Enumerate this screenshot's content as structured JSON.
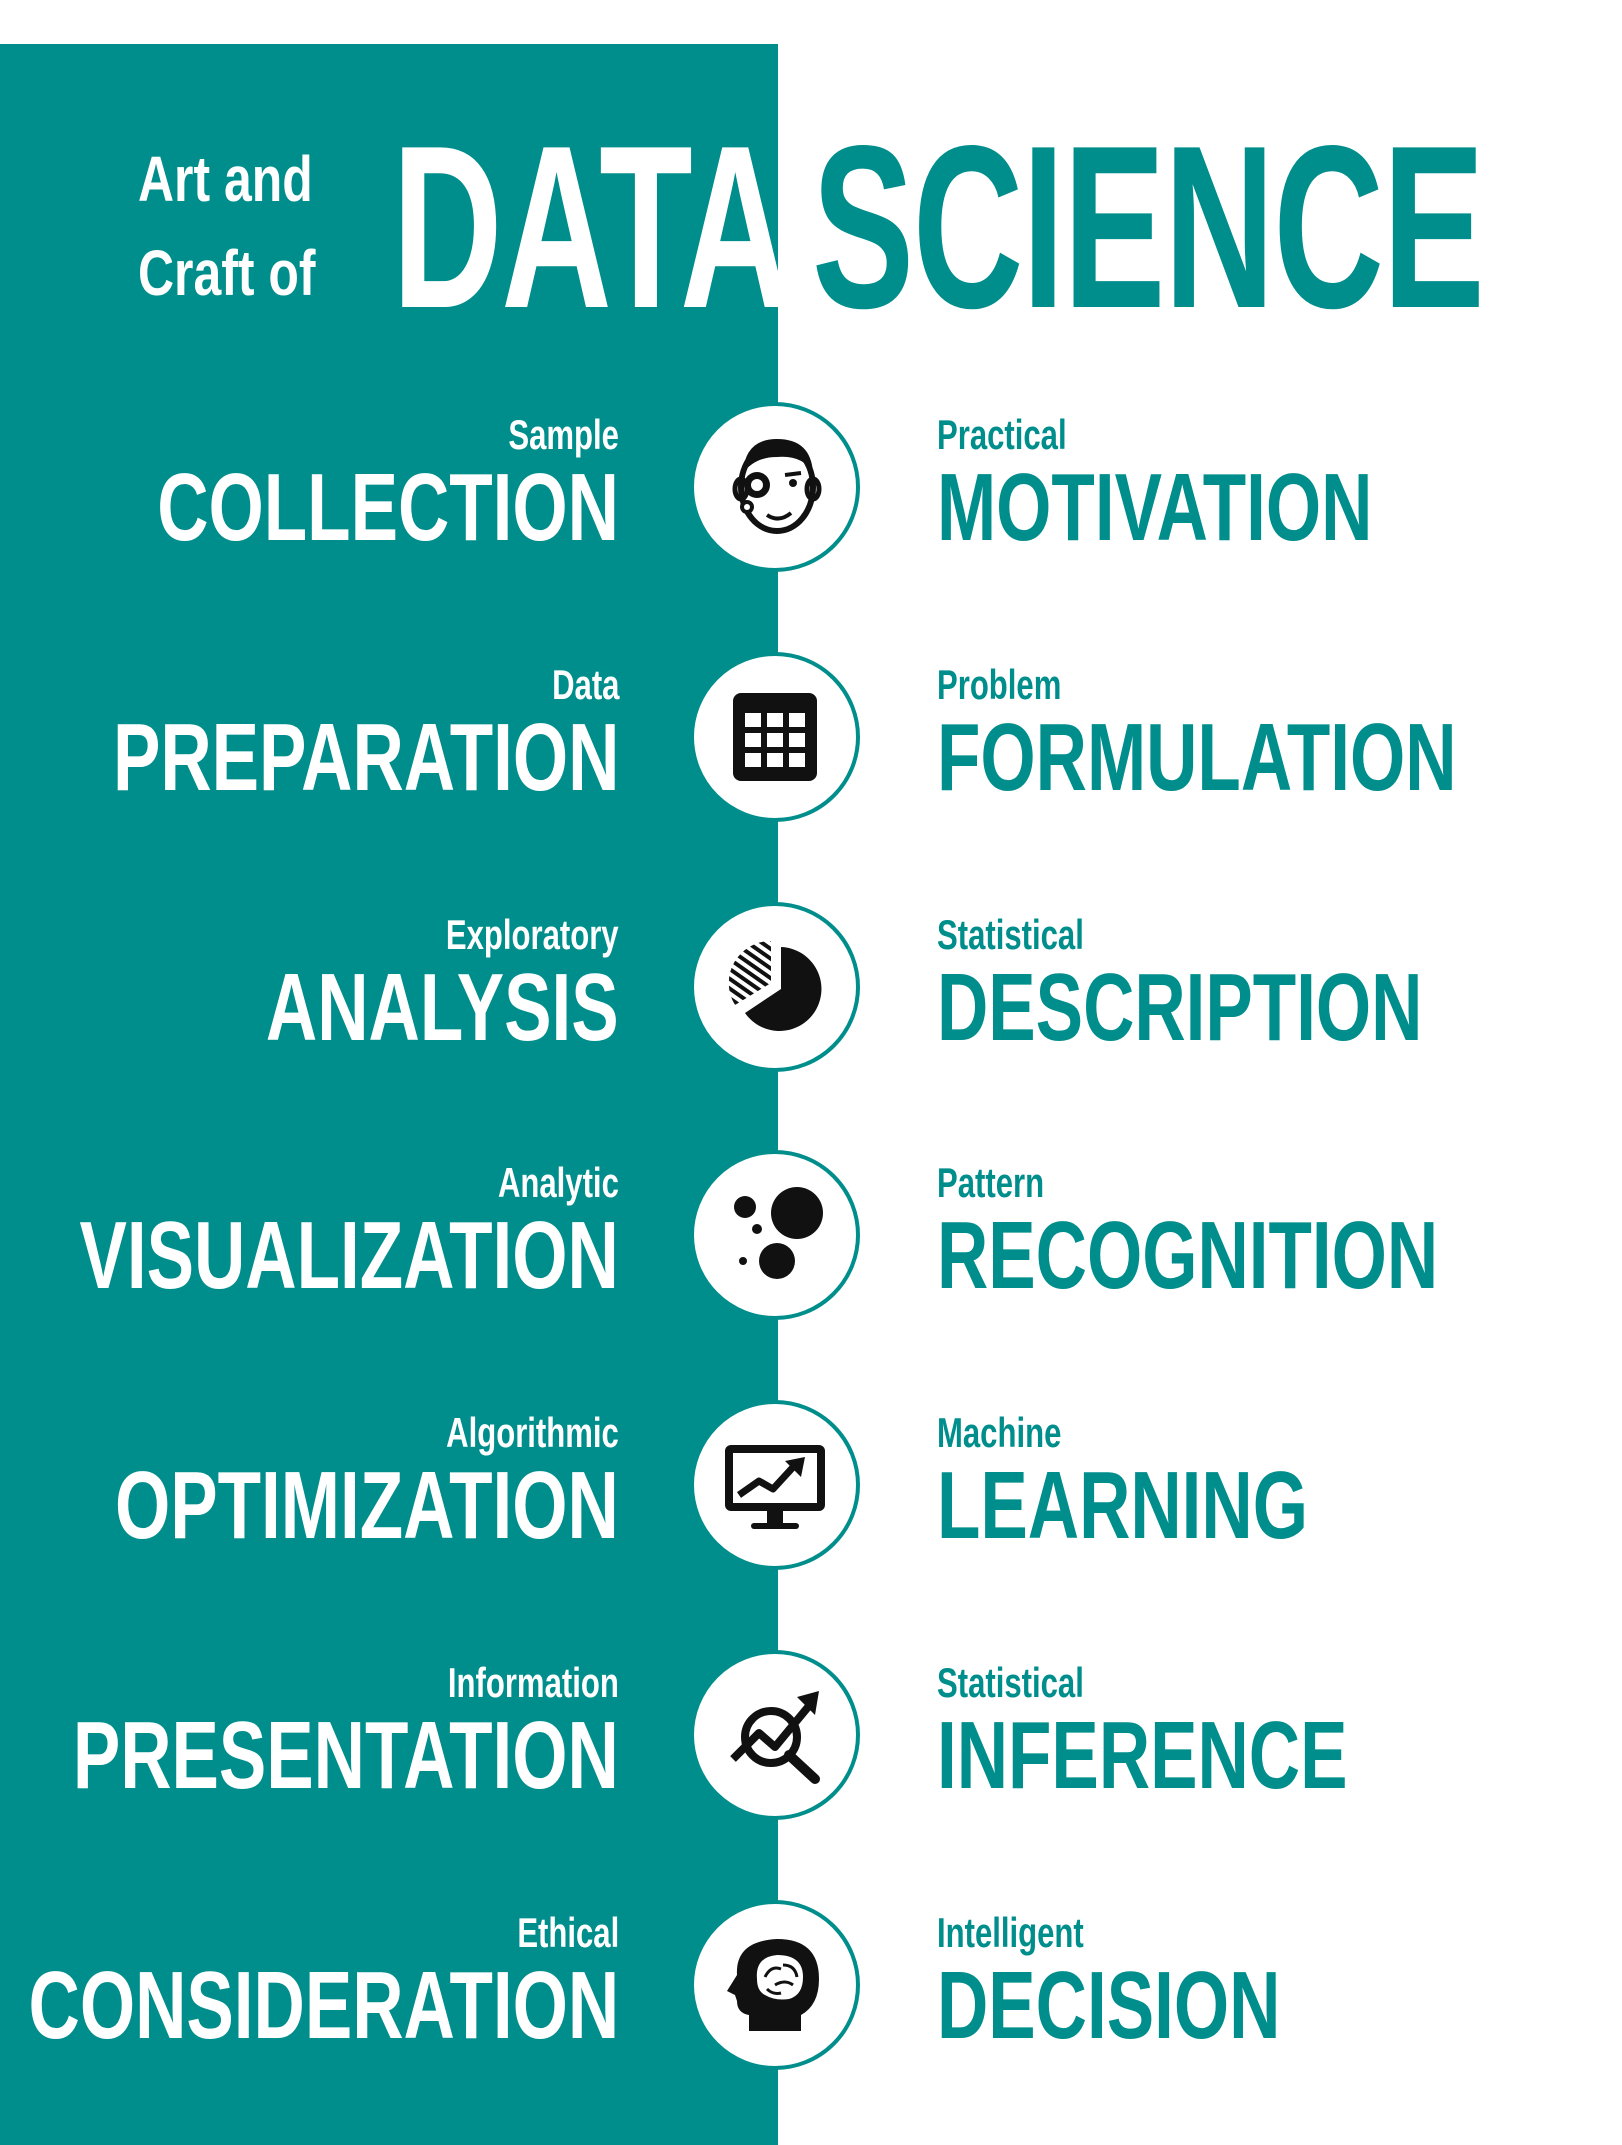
{
  "title": {
    "small_line1": "Art and",
    "small_line2": "Craft of",
    "big_left": "DATA",
    "big_right": "SCIENCE"
  },
  "colors": {
    "teal": "#008e8c",
    "white": "#ffffff",
    "icon": "#111111"
  },
  "rows": [
    {
      "left_small": "Sample",
      "left_big": "COLLECTION",
      "icon": "face-gear-icon",
      "right_small": "Practical",
      "right_big": "MOTIVATION"
    },
    {
      "left_small": "Data",
      "left_big": "PREPARATION",
      "icon": "table-grid-icon",
      "right_small": "Problem",
      "right_big": "FORMULATION"
    },
    {
      "left_small": "Exploratory",
      "left_big": "ANALYSIS",
      "icon": "pie-chart-icon",
      "right_small": "Statistical",
      "right_big": "DESCRIPTION"
    },
    {
      "left_small": "Analytic",
      "left_big": "VISUALIZATION",
      "icon": "bubbles-icon",
      "right_small": "Pattern",
      "right_big": "RECOGNITION"
    },
    {
      "left_small": "Algorithmic",
      "left_big": "OPTIMIZATION",
      "icon": "monitor-chart-icon",
      "right_small": "Machine",
      "right_big": "LEARNING"
    },
    {
      "left_small": "Information",
      "left_big": "PRESENTATION",
      "icon": "magnifier-trend-icon",
      "right_small": "Statistical",
      "right_big": "INFERENCE"
    },
    {
      "left_small": "Ethical",
      "left_big": "CONSIDERATION",
      "icon": "head-brain-icon",
      "right_small": "Intelligent",
      "right_big": "DECISION"
    }
  ]
}
